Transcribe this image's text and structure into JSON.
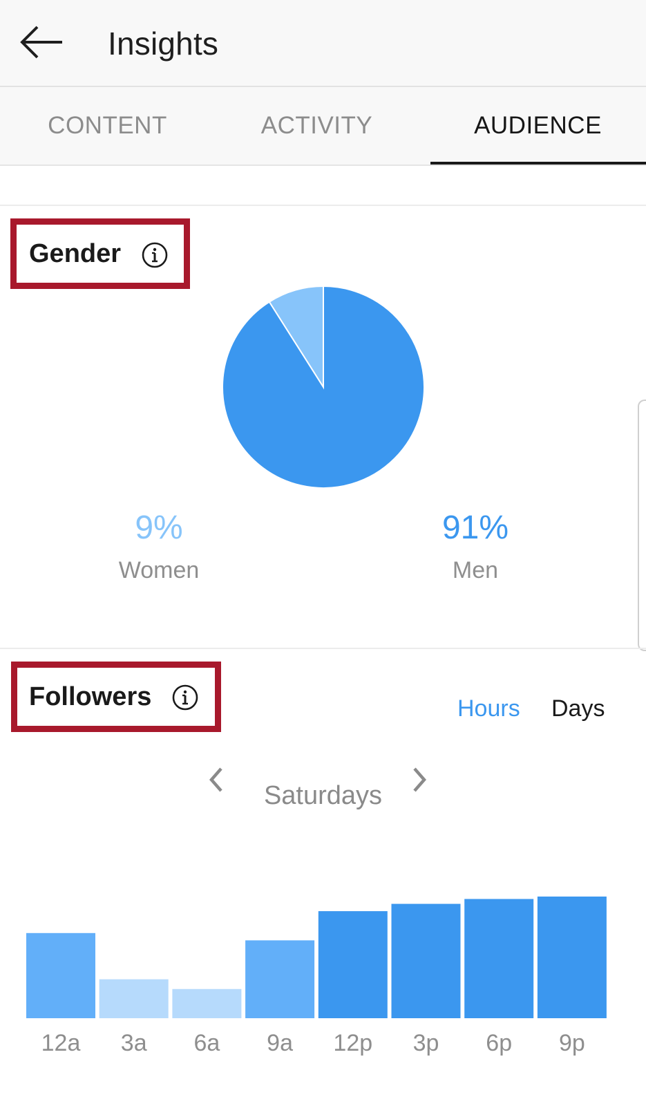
{
  "header": {
    "title": "Insights",
    "back_icon": "arrow-left-icon"
  },
  "tabs": [
    {
      "label": "CONTENT",
      "active": false
    },
    {
      "label": "ACTIVITY",
      "active": false
    },
    {
      "label": "AUDIENCE",
      "active": true
    }
  ],
  "gender": {
    "title": "Gender",
    "info_icon": "info-icon",
    "women": {
      "percent": "9%",
      "label": "Women"
    },
    "men": {
      "percent": "91%",
      "label": "Men"
    }
  },
  "followers": {
    "title": "Followers",
    "info_icon": "info-icon",
    "toggle": {
      "hours": "Hours",
      "days": "Days",
      "selected": "Hours"
    },
    "day": "Saturdays",
    "prev_icon": "chevron-left-icon",
    "next_icon": "chevron-right-icon"
  },
  "colors": {
    "accent": "#3b97ef",
    "women": "#87c4fa",
    "bar_mid": "#62aff9",
    "bar_light": "#b6dafc",
    "highlight_box": "#a8192c"
  },
  "chart_data": [
    {
      "type": "pie",
      "categories": [
        "Women",
        "Men"
      ],
      "values": [
        9,
        91
      ]
    },
    {
      "type": "bar",
      "categories": [
        "12a",
        "3a",
        "6a",
        "9a",
        "12p",
        "3p",
        "6p",
        "9p"
      ],
      "values": [
        70,
        32,
        24,
        64,
        88,
        94,
        98,
        100
      ],
      "ylim": [
        0,
        100
      ]
    }
  ]
}
